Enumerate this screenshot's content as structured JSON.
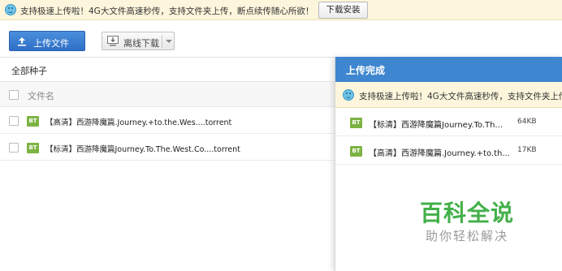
{
  "promo": {
    "text": "支持极速上传啦！4G大文件高速秒传，支持文件夹上传，断点续传随心所欲！",
    "install_label": "下载安装"
  },
  "toolbar": {
    "upload_label": "上传文件",
    "offline_label": "离线下载"
  },
  "main": {
    "section_title": "全部种子",
    "column_name": "文件名",
    "rows": [
      {
        "badge": "BT",
        "name": "【高清】西游降魔篇.Journey.+to.the.Wes....torrent"
      },
      {
        "badge": "BT",
        "name": "【标清】西游降魔篇Journey.To.The.West.Co....torrent"
      }
    ]
  },
  "panel": {
    "title": "上传完成",
    "promo_text": "支持极速上传啦！4G大文件高速秒传，支持文件夹上传",
    "rows": [
      {
        "badge": "BT",
        "name": "【标清】西游降魔篇Journey.To.Th...",
        "size": "64KB"
      },
      {
        "badge": "BT",
        "name": "【高清】西游降魔篇.Journey.+to.th...",
        "size": "17KB"
      }
    ]
  },
  "watermark": {
    "title": "百科全说",
    "subtitle": "助你轻松解决"
  },
  "colors": {
    "accent": "#3e86cf",
    "bt_badge": "#7cb342",
    "promo_bg": "#fdf6dc",
    "watermark": "#43b049"
  },
  "icons": [
    "smile-icon",
    "upload-arrow-icon",
    "offline-download-icon",
    "chevron-down-icon",
    "bt-file-icon"
  ]
}
